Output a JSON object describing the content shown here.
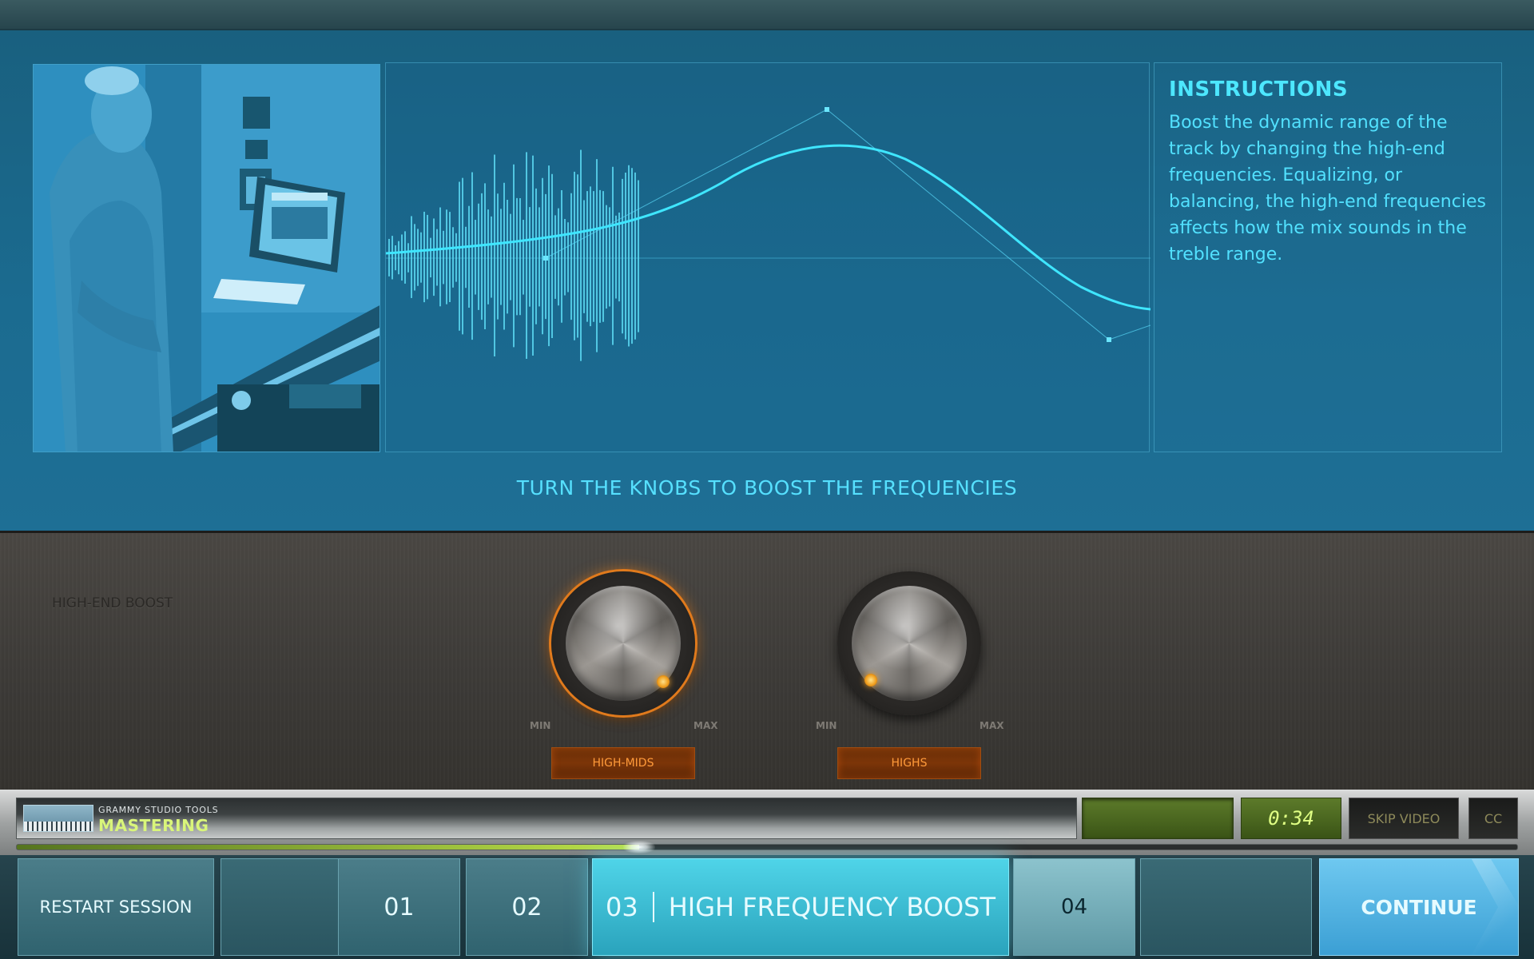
{
  "instructions": {
    "title": "INSTRUCTIONS",
    "body": "Boost the dynamic range of the track by changing the high-end frequencies. Equalizing, or balancing, the high-end frequencies affects how the mix sounds in the treble range."
  },
  "prompt": "TURN THE KNOBS TO BOOST THE FREQUENCIES",
  "hardware": {
    "label": "HIGH-END BOOST",
    "knobs": [
      {
        "name": "HIGH-MIDS",
        "min_label": "MIN",
        "max_label": "MAX",
        "active": true
      },
      {
        "name": "HIGHS",
        "min_label": "MIN",
        "max_label": "MAX",
        "active": false
      }
    ]
  },
  "player": {
    "brand_small": "GRAMMY STUDIO TOOLS",
    "brand_big": "MASTERING",
    "time": "0:34",
    "skip_label": "SKIP VIDEO",
    "cc_label": "CC",
    "progress": 0.415
  },
  "nav": {
    "restart": "RESTART SESSION",
    "steps": [
      {
        "number": "01",
        "label": ""
      },
      {
        "number": "02",
        "label": ""
      },
      {
        "number": "03",
        "label": "HIGH FREQUENCY BOOST"
      },
      {
        "number": "04",
        "label": ""
      }
    ],
    "continue": "CONTINUE"
  },
  "colors": {
    "accent_cyan": "#4de7ff",
    "knob_orange": "#ff9a3a",
    "lcd_green": "#e0ff84"
  }
}
